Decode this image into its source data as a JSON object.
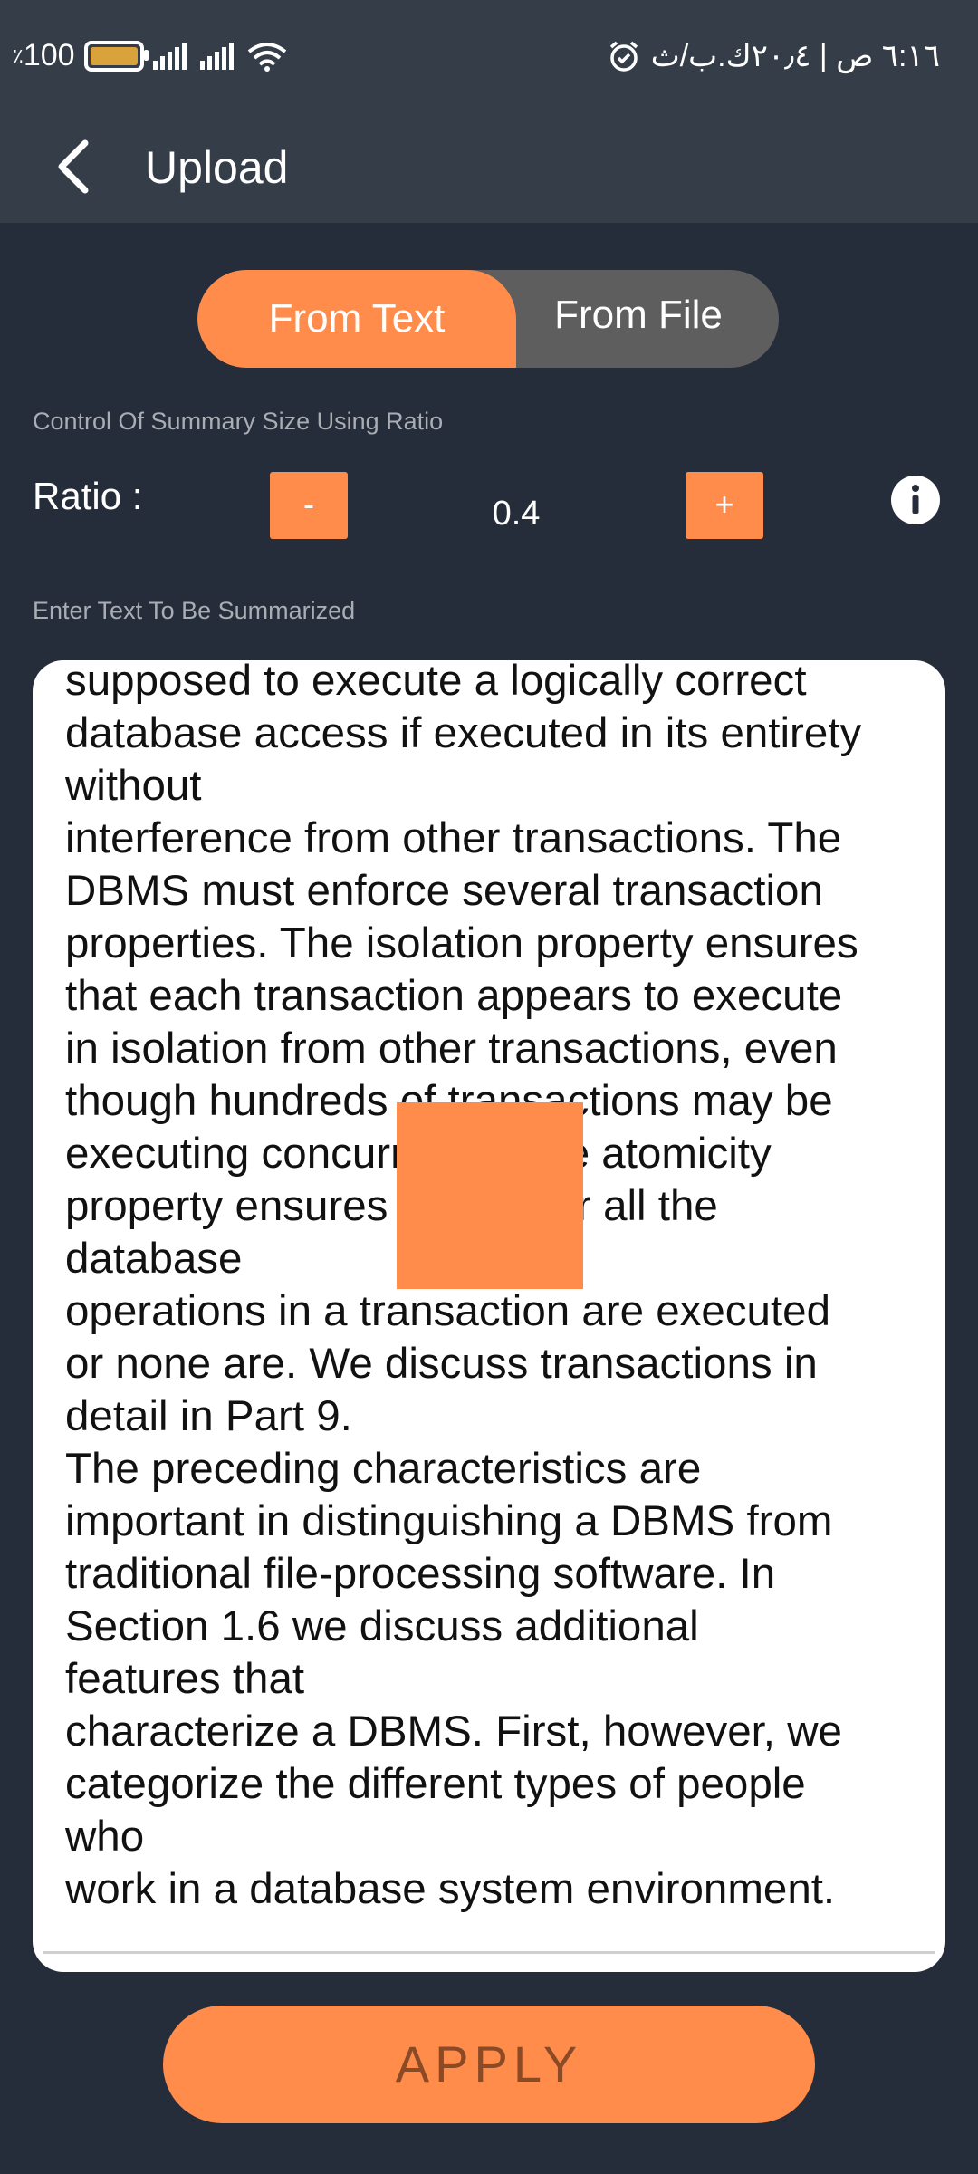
{
  "status_bar": {
    "battery_percent": "100",
    "battery_prefix": "٪",
    "time_text": "٦:١٦ ص | ٢٠٫٤ك.ب/ث"
  },
  "app_bar": {
    "title": "Upload",
    "back_icon": "chevron-left-icon"
  },
  "source_toggle": {
    "options": [
      "From Text",
      "From File"
    ],
    "selected": "From Text"
  },
  "ratio_section": {
    "hint": "Control Of Summary Size Using Ratio",
    "label": "Ratio :",
    "decrement_label": "-",
    "value": "0.4",
    "increment_label": "+",
    "info_icon": "info-icon"
  },
  "text_section": {
    "hint": "Enter Text To Be Summarized",
    "content": "supposed to execute a logically correct\ndatabase access if executed in its entirety\nwithout\ninterference from other transactions. The\nDBMS must enforce several transaction\nproperties. The isolation property ensures\nthat each transaction appears to execute\nin isolation from other transactions, even\nthough hundreds of transactions may be\nexecuting concurrently. The atomicity\nproperty ensures that either all the\ndatabase\noperations in a transaction are executed\nor none are. We discuss transactions in\ndetail in Part 9.\nThe preceding characteristics are\nimportant in distinguishing a DBMS from\ntraditional file-processing software. In\nSection 1.6 we discuss additional\nfeatures that\ncharacterize a DBMS. First, however, we\ncategorize the different types of people\nwho\nwork in a database system environment."
  },
  "apply_button": {
    "label": "APPLY"
  },
  "colors": {
    "accent": "#ff8c4b",
    "background": "#262d3a",
    "bar": "#353d48",
    "toggle_inactive": "#5e5e5e"
  }
}
